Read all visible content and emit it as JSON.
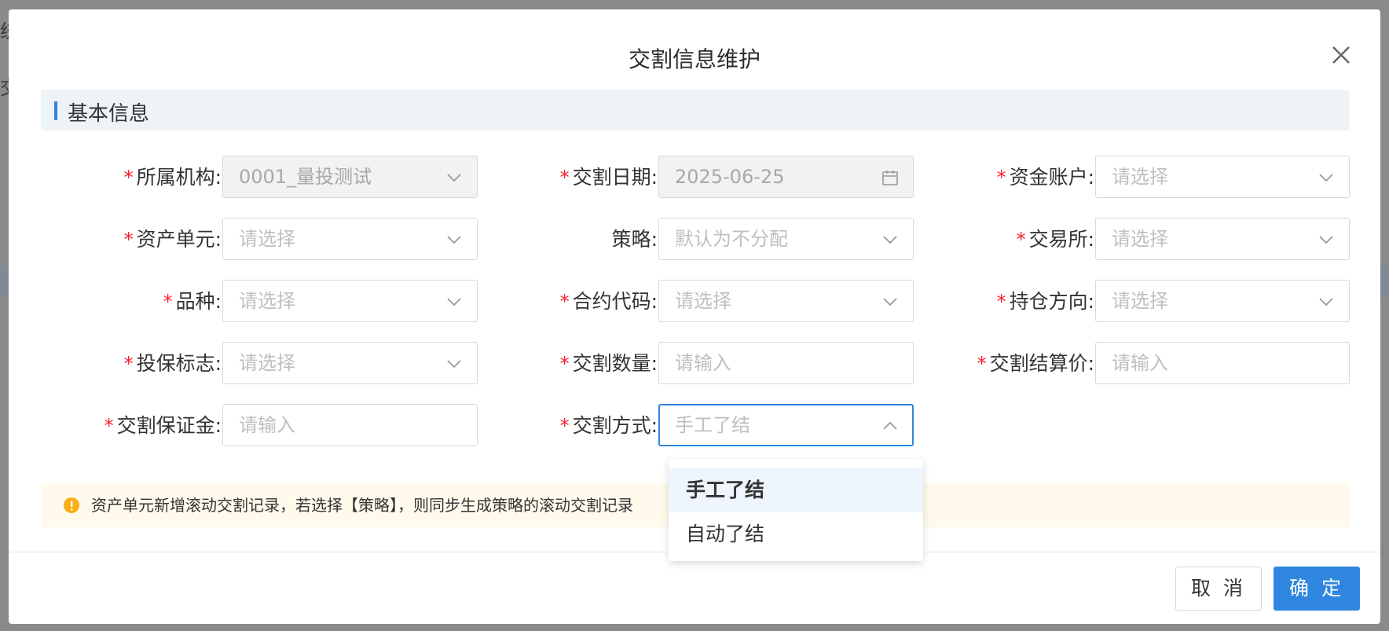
{
  "background": {
    "left_fragments": [
      "统",
      "交"
    ]
  },
  "modal": {
    "title": "交割信息维护",
    "section_title": "基本信息",
    "fields": [
      {
        "label": "所属机构:",
        "required": true,
        "value": "0001_量投测试",
        "icon": "chevron-down-icon",
        "disabled": true
      },
      {
        "label": "交割日期:",
        "required": true,
        "value": "2025-06-25",
        "icon": "calendar-icon",
        "disabled": true
      },
      {
        "label": "资金账户:",
        "required": true,
        "placeholder": "请选择",
        "icon": "chevron-down-icon"
      },
      {
        "label": "资产单元:",
        "required": true,
        "placeholder": "请选择",
        "icon": "chevron-down-icon"
      },
      {
        "label": "策略:",
        "required": false,
        "placeholder": "默认为不分配",
        "icon": "chevron-down-icon"
      },
      {
        "label": "交易所:",
        "required": true,
        "placeholder": "请选择",
        "icon": "chevron-down-icon"
      },
      {
        "label": "品种:",
        "required": true,
        "placeholder": "请选择",
        "icon": "chevron-down-icon"
      },
      {
        "label": "合约代码:",
        "required": true,
        "placeholder": "请选择",
        "icon": "chevron-down-icon"
      },
      {
        "label": "持仓方向:",
        "required": true,
        "placeholder": "请选择",
        "icon": "chevron-down-icon"
      },
      {
        "label": "投保标志:",
        "required": true,
        "placeholder": "请选择",
        "icon": "chevron-down-icon"
      },
      {
        "label": "交割数量:",
        "required": true,
        "placeholder": "请输入"
      },
      {
        "label": "交割结算价:",
        "required": true,
        "placeholder": "请输入"
      },
      {
        "label": "交割保证金:",
        "required": true,
        "placeholder": "请输入"
      },
      {
        "label": "交割方式:",
        "required": true,
        "placeholder": "手工了结",
        "icon": "chevron-up-icon",
        "active": true
      }
    ],
    "dropdown": {
      "options": [
        "手工了结",
        "自动了结"
      ],
      "selected": "手工了结"
    },
    "alert": {
      "text": "资产单元新增滚动交割记录，若选择【策略】，则同步生成策略的滚动交割记录",
      "icon": "warning-icon",
      "color": "#faad14"
    },
    "buttons": {
      "cancel": "取 消",
      "ok": "确 定"
    }
  },
  "colors": {
    "primary": "#2e86de",
    "required_mark": "#f5222d",
    "placeholder": "#bfbfbf"
  }
}
